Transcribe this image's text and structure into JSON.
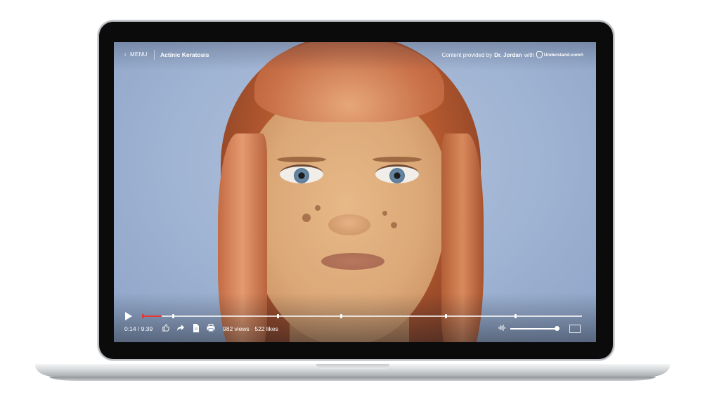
{
  "player": {
    "menu_label": "MENU",
    "title": "Actinic Keratosis",
    "credit_prefix": "Content provided by",
    "credit_author": "Dr. Jordan",
    "credit_with": "with",
    "brand": "Understand.com®",
    "time_display": "0:14 / 9:39",
    "stats": "982 views · 522 likes",
    "progress_fraction": 0.043,
    "chapter_marker_fractions": [
      0.068,
      0.307,
      0.451,
      0.69,
      0.848
    ],
    "volume_fraction": 0.97,
    "accent_color": "#e53935"
  },
  "icons": [
    "chevron-left-icon",
    "play-icon",
    "thumbs-up-icon",
    "share-icon",
    "document-icon",
    "print-icon",
    "audio-description-icon",
    "fullscreen-icon"
  ]
}
